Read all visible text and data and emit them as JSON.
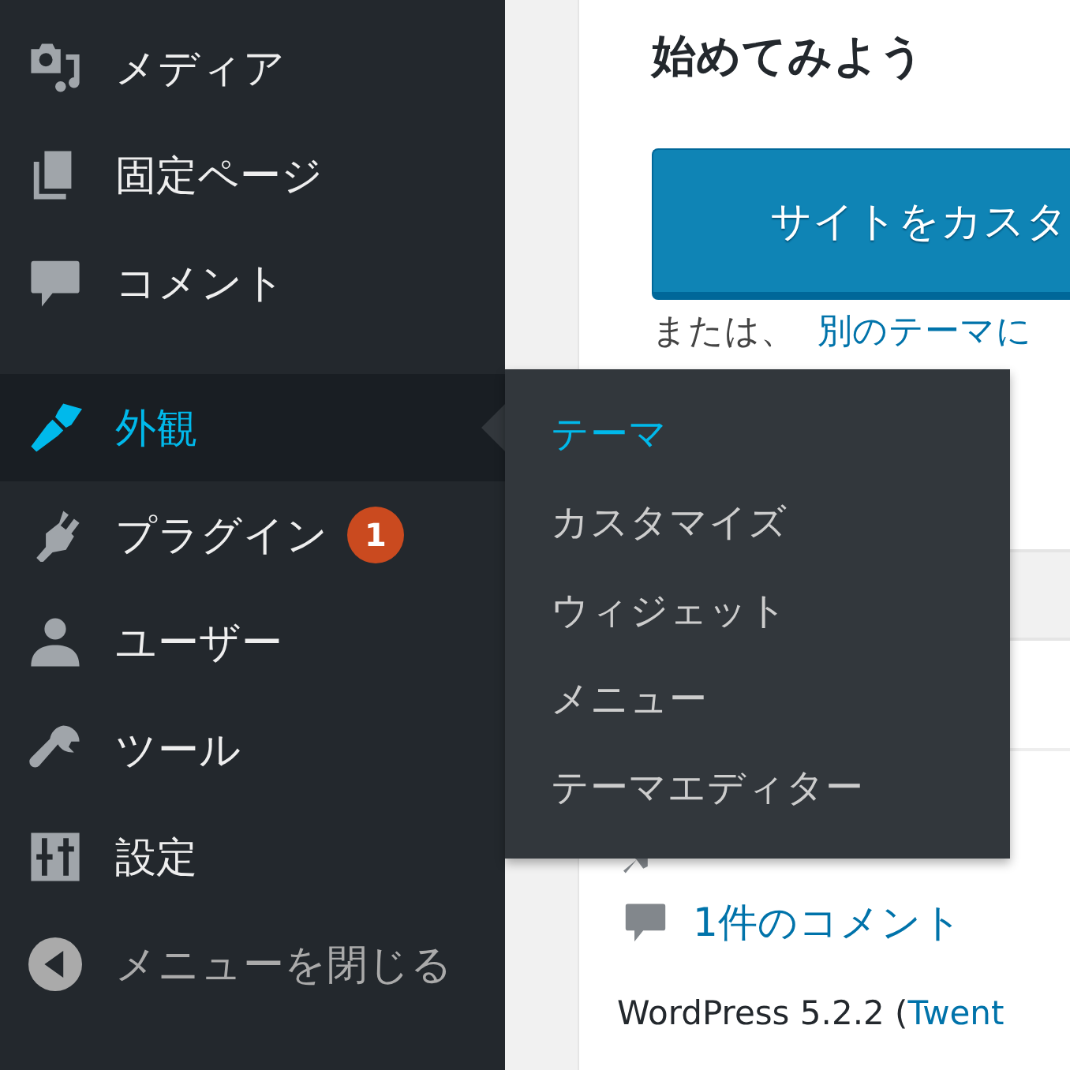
{
  "sidebar": {
    "items": [
      {
        "label": "メディア",
        "selected": false
      },
      {
        "label": "固定ページ",
        "selected": false
      },
      {
        "label": "コメント",
        "selected": false
      },
      {
        "label": "外観",
        "selected": true
      },
      {
        "label": "プラグイン",
        "selected": false,
        "badge": "1"
      },
      {
        "label": "ユーザー",
        "selected": false
      },
      {
        "label": "ツール",
        "selected": false
      },
      {
        "label": "設定",
        "selected": false
      }
    ],
    "collapse": "メニューを閉じる"
  },
  "flyout": {
    "items": [
      {
        "label": "テーマ",
        "selected": true
      },
      {
        "label": "カスタマイズ",
        "selected": false
      },
      {
        "label": "ウィジェット",
        "selected": false
      },
      {
        "label": "メニュー",
        "selected": false
      },
      {
        "label": "テーマエディター",
        "selected": false
      }
    ]
  },
  "main": {
    "heading": "始めてみよう",
    "button": "サイトをカスタ",
    "alt_text": "または、",
    "alt_link": "別のテーマに",
    "stats": [
      {
        "label": "1件のコメント"
      }
    ],
    "version_text": "WordPress 5.2.2 (",
    "version_link": "Twent"
  }
}
